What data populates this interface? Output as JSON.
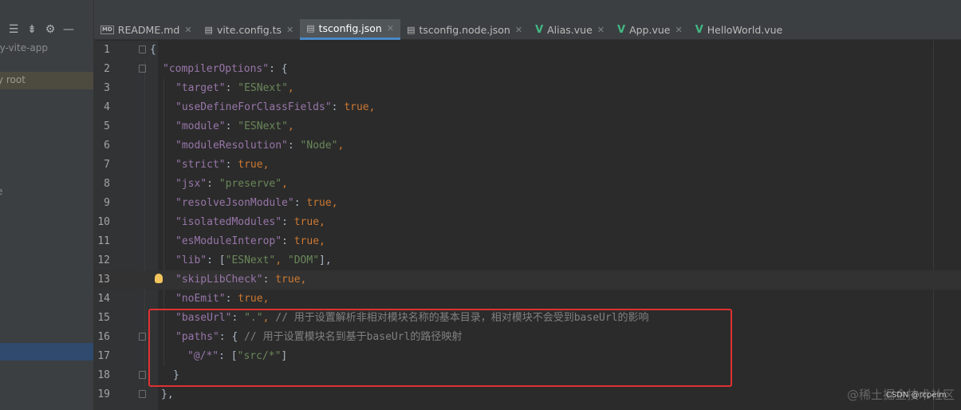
{
  "sidebar": {
    "project_name": "ny-vite-app",
    "root_label": "ry root",
    "item_label": "e"
  },
  "tabs": [
    {
      "label": "README.md",
      "icon": "markdown-file-icon",
      "active": false
    },
    {
      "label": "vite.config.ts",
      "icon": "typescript-file-icon",
      "active": false
    },
    {
      "label": "tsconfig.json",
      "icon": "json-file-icon",
      "active": true
    },
    {
      "label": "tsconfig.node.json",
      "icon": "json-file-icon",
      "active": false
    },
    {
      "label": "Alias.vue",
      "icon": "vue-file-icon",
      "active": false
    },
    {
      "label": "App.vue",
      "icon": "vue-file-icon",
      "active": false
    },
    {
      "label": "HelloWorld.vue",
      "icon": "vue-file-icon",
      "active": false
    }
  ],
  "editor": {
    "line_numbers": [
      "1",
      "2",
      "3",
      "4",
      "5",
      "6",
      "7",
      "8",
      "9",
      "10",
      "11",
      "12",
      "13",
      "14",
      "15",
      "16",
      "17",
      "18",
      "19"
    ],
    "current_line": "13",
    "lines": {
      "l1": {
        "p": "{"
      },
      "l2": {
        "k": "\"compilerOptions\"",
        "p": ": {"
      },
      "l3": {
        "k": "\"target\"",
        "p": ": ",
        "s": "\"ESNext\"",
        "e": ","
      },
      "l4": {
        "k": "\"useDefineForClassFields\"",
        "p": ": ",
        "v": "true",
        "e": ","
      },
      "l5": {
        "k": "\"module\"",
        "p": ": ",
        "s": "\"ESNext\"",
        "e": ","
      },
      "l6": {
        "k": "\"moduleResolution\"",
        "p": ": ",
        "s": "\"Node\"",
        "e": ","
      },
      "l7": {
        "k": "\"strict\"",
        "p": ": ",
        "v": "true",
        "e": ","
      },
      "l8": {
        "k": "\"jsx\"",
        "p": ": ",
        "s": "\"preserve\"",
        "e": ","
      },
      "l9": {
        "k": "\"resolveJsonModule\"",
        "p": ": ",
        "v": "true",
        "e": ","
      },
      "l10": {
        "k": "\"isolatedModules\"",
        "p": ": ",
        "v": "true",
        "e": ","
      },
      "l11": {
        "k": "\"esModuleInterop\"",
        "p": ": ",
        "v": "true",
        "e": ","
      },
      "l12": {
        "k": "\"lib\"",
        "p": ": [",
        "s1": "\"ESNext\"",
        "sep": ", ",
        "s2": "\"DOM\"",
        "e": "],"
      },
      "l13": {
        "k": "\"skipLibCheck\"",
        "p": ": ",
        "v": "true",
        "e": ","
      },
      "l14": {
        "k": "\"noEmit\"",
        "p": ": ",
        "v": "true",
        "e": ","
      },
      "l15": {
        "k": "\"baseUrl\"",
        "p": ": ",
        "s": "\".\"",
        "e": ", ",
        "c": "// 用于设置解析非相对模块名称的基本目录，相对模块不会受到baseUrl的影响"
      },
      "l16": {
        "k": "\"paths\"",
        "p": ": { ",
        "c": "// 用于设置模块名到基于baseUrl的路径映射"
      },
      "l17": {
        "k": "\"@/*\"",
        "p": ": [",
        "s": "\"src/*\"",
        "e": "]"
      },
      "l18": {
        "p": "}"
      },
      "l19": {
        "p": "},"
      }
    }
  },
  "watermark": {
    "site": "@稀土掘金技术社区",
    "author": "CSDN @rcpeim"
  },
  "colors": {
    "key": "#9876aa",
    "string": "#6a8759",
    "boolean": "#cc7832",
    "comment": "#808080",
    "highlight_box": "#e03131"
  }
}
